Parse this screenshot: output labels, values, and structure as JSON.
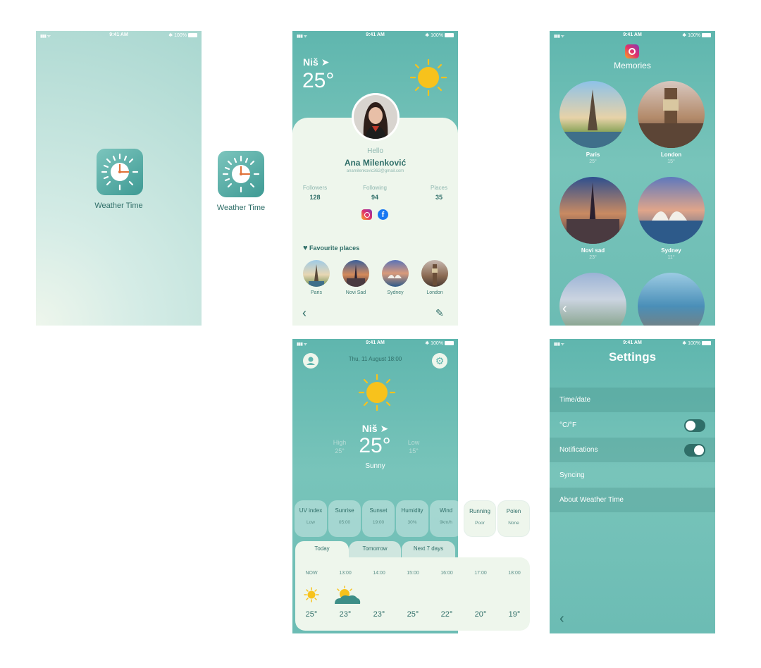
{
  "status": {
    "time": "9:41 AM",
    "battery": "100%",
    "signal": "▮▮▮ ᯤ",
    "bt": "✱"
  },
  "splash": {
    "app_name": "Weather Time"
  },
  "standalone_icon": {
    "app_name": "Weather Time"
  },
  "profile": {
    "city": "Niš",
    "temperature": "25°",
    "greeting": "Hello",
    "name": "Ana Milenković",
    "email": "anamilenkovic362@gmail.com",
    "stats": [
      {
        "label": "Followers",
        "value": "128"
      },
      {
        "label": "Following",
        "value": "94"
      },
      {
        "label": "Places",
        "value": "35"
      }
    ],
    "favourites_title": "Favourite places",
    "favourites": [
      "Paris",
      "Novi Sad",
      "Sydney",
      "London"
    ]
  },
  "memories": {
    "title": "Memories",
    "places": [
      {
        "name": "Paris",
        "temp": "25°"
      },
      {
        "name": "London",
        "temp": "15°"
      },
      {
        "name": "Novi sad",
        "temp": "23°"
      },
      {
        "name": "Sydney",
        "temp": "11°"
      }
    ]
  },
  "home": {
    "date": "Thu, 11 August 18:00",
    "city": "Niš",
    "high_label": "High",
    "high_value": "25°",
    "temperature": "25°",
    "low_label": "Low",
    "low_value": "15°",
    "condition": "Sunny",
    "cards": [
      {
        "title": "UV index",
        "value": "Low"
      },
      {
        "title": "Sunrise",
        "value": "05:00"
      },
      {
        "title": "Sunset",
        "value": "19:00"
      },
      {
        "title": "Humidity",
        "value": "30%"
      },
      {
        "title": "Wind",
        "value": "9km/h"
      },
      {
        "title": "Running",
        "value": "Poor"
      },
      {
        "title": "Polen",
        "value": "None"
      }
    ],
    "tabs": [
      "Today",
      "Tomorrow",
      "Next 7 days"
    ],
    "hours": [
      {
        "time": "NOW",
        "temp": "25°"
      },
      {
        "time": "13:00",
        "temp": "23°"
      },
      {
        "time": "14:00",
        "temp": "23°"
      },
      {
        "time": "15:00",
        "temp": "25°"
      },
      {
        "time": "16:00",
        "temp": "22°"
      },
      {
        "time": "17:00",
        "temp": "20°"
      },
      {
        "time": "18:00",
        "temp": "19°"
      }
    ]
  },
  "settings": {
    "title": "Settings",
    "rows": [
      "Time/date",
      "°C/°F",
      "Notifications",
      "Syncing",
      "About Weather Time"
    ]
  },
  "colors": {
    "teal": "#5fb6ae",
    "dark_teal": "#2f6e68",
    "sun": "#f7c21c",
    "card": "#eef6ec"
  }
}
